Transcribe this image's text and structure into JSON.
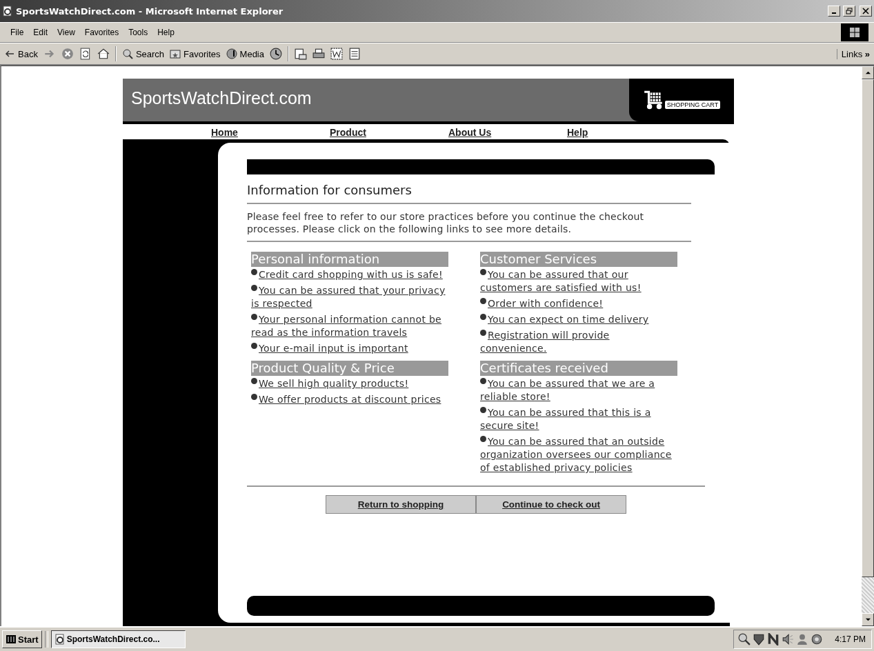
{
  "window": {
    "title": "SportsWatchDirect.com - Microsoft Internet Explorer"
  },
  "menu": [
    "File",
    "Edit",
    "View",
    "Favorites",
    "Tools",
    "Help"
  ],
  "toolbar": {
    "back": "Back",
    "search": "Search",
    "favorites": "Favorites",
    "media": "Media",
    "links": "Links",
    "more": "»"
  },
  "site": {
    "logo": "SportsWatchDirect.com",
    "cart": "SHOPPING CART",
    "nav": [
      "Home",
      "Product",
      "About Us",
      "Help"
    ]
  },
  "heading": "Information for consumers",
  "intro": "Please feel free to refer to our store practices before you continue the checkout processes. Please click on the following links to see more details.",
  "sections": [
    {
      "title": "Personal information",
      "links": [
        "Credit card shopping with us is safe!",
        "You can be assured that your privacy is respected",
        "Your personal information cannot be read as the information travels",
        "Your e-mail input is important"
      ]
    },
    {
      "title": "Customer Services",
      "links": [
        "You can be assured that our customers are satisfied with us!",
        "Order with confidence!",
        "You can expect on time delivery",
        "Registration will provide convenience."
      ]
    },
    {
      "title": "Product Quality & Price",
      "links": [
        "We sell high quality products!",
        "We offer products at discount prices"
      ]
    },
    {
      "title": "Certificates received",
      "links": [
        "You can be assured that we are a reliable store!",
        "You can be assured that this is a secure site!",
        "You can be assured that an outside organization oversees our compliance of established privacy policies"
      ]
    }
  ],
  "buttons": [
    "Return to shopping",
    "Continue to check out"
  ],
  "taskbar": {
    "start": "Start",
    "task": "SportsWatchDirect.co...",
    "clock": "4:17 PM"
  }
}
